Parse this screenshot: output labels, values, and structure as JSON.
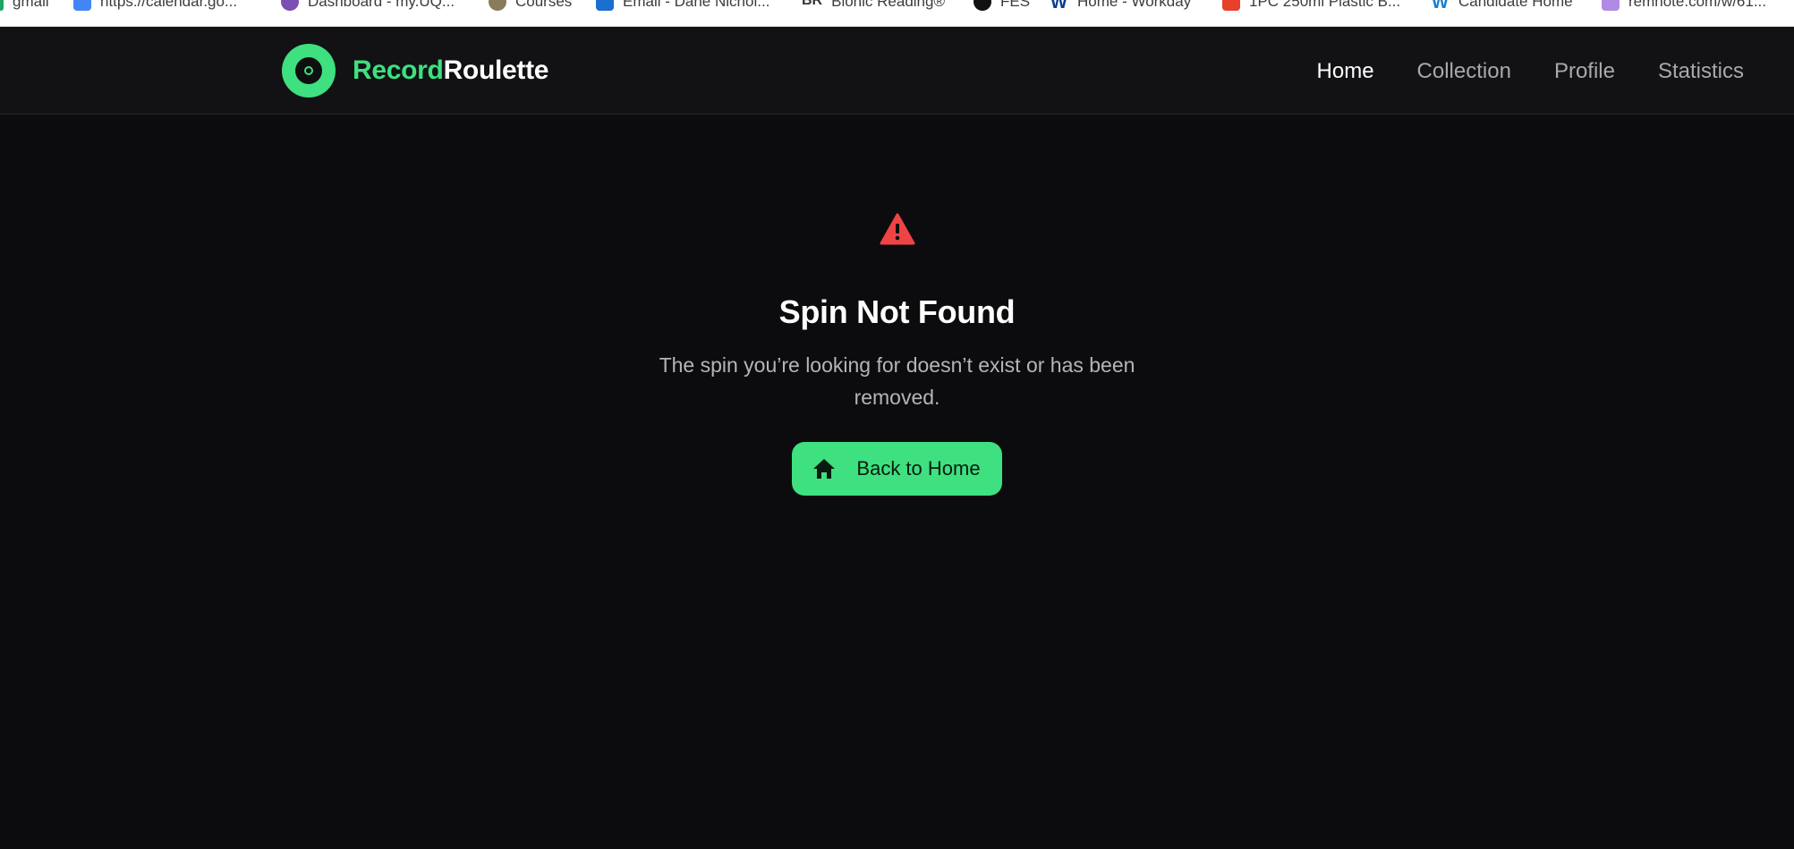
{
  "bookmarks": [
    {
      "label": "gmail",
      "color": "#1fa463"
    },
    {
      "label": "https://calendar.go...",
      "color": "#4285f4"
    },
    {
      "label": "Dashboard - my.UQ...",
      "color": "#7b4fb3"
    },
    {
      "label": "Courses",
      "color": "#8a7b5a"
    },
    {
      "label": "Email - Dane Nichol...",
      "color": "#1a6fd0"
    },
    {
      "label": "Bionic Reading®",
      "color": "#333333"
    },
    {
      "label": "FES",
      "color": "#111111"
    },
    {
      "label": "Home - Workday",
      "color": "#0b3d91"
    },
    {
      "label": "1PC 250ml Plastic B...",
      "color": "#e8402a"
    },
    {
      "label": "Candidate Home",
      "color": "#1a7fd0"
    },
    {
      "label": "remnote.com/w/61...",
      "color": "#b28ae6"
    }
  ],
  "brand": {
    "part1": "Record",
    "part2": "Roulette"
  },
  "nav": {
    "home": "Home",
    "collection": "Collection",
    "profile": "Profile",
    "statistics": "Statistics"
  },
  "error": {
    "title": "Spin Not Found",
    "message": "The spin you’re looking for doesn’t exist or has been removed.",
    "button_label": "Back to Home",
    "icon": "warning-triangle-icon"
  },
  "colors": {
    "accent": "#3ee07f",
    "warning": "#ef4444",
    "background": "#0c0c0e"
  }
}
